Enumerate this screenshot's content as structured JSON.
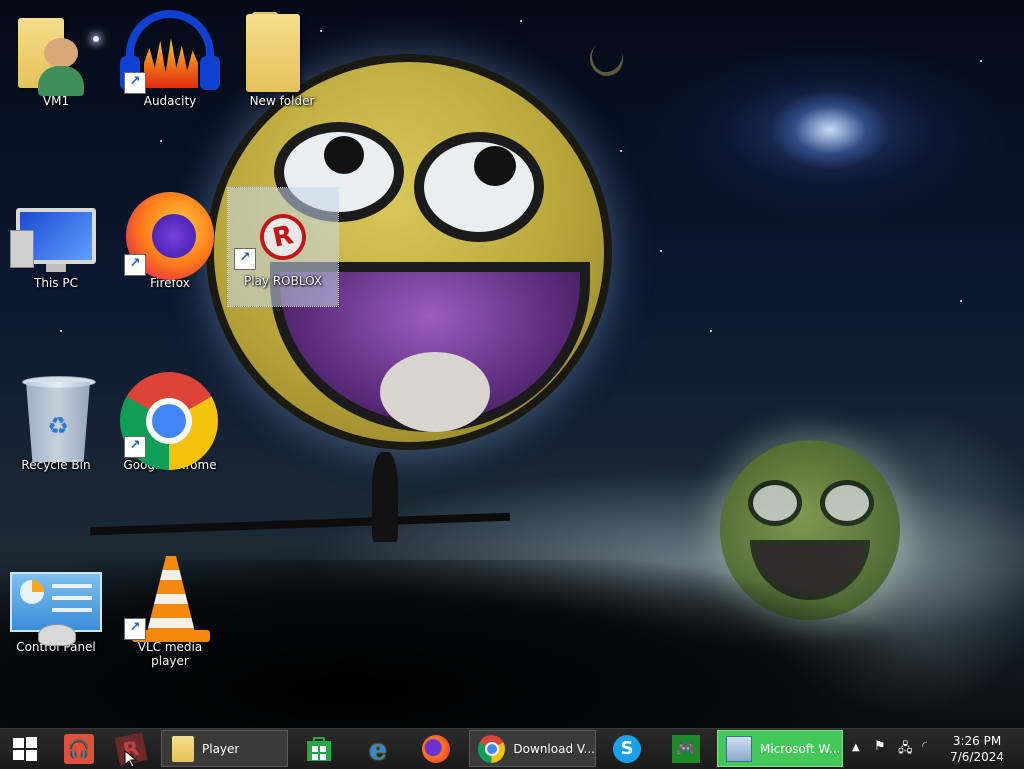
{
  "desktop": {
    "icons": [
      {
        "label": "VM1",
        "icon": "user-folder-icon",
        "shortcut": false
      },
      {
        "label": "Audacity",
        "icon": "audacity-icon",
        "shortcut": true
      },
      {
        "label": "New folder",
        "icon": "folder-icon",
        "shortcut": false
      },
      {
        "label": "This PC",
        "icon": "computer-icon",
        "shortcut": false
      },
      {
        "label": "Firefox",
        "icon": "firefox-icon",
        "shortcut": true
      },
      {
        "label": "Play ROBLOX",
        "icon": "roblox-icon",
        "shortcut": true,
        "selected": true
      },
      {
        "label": "Recycle Bin",
        "icon": "recycle-bin-icon",
        "shortcut": false
      },
      {
        "label": "Google Chrome",
        "icon": "chrome-icon",
        "shortcut": true
      },
      {
        "label": "Control Panel",
        "icon": "control-panel-icon",
        "shortcut": false
      },
      {
        "label": "VLC media player",
        "icon": "vlc-icon",
        "shortcut": true
      }
    ]
  },
  "taskbar": {
    "start_icon": "windows-start-icon",
    "pinned": [
      {
        "icon": "headphones-app-icon"
      },
      {
        "icon": "roblox-taskbar-icon"
      },
      {
        "icon": "store-icon"
      },
      {
        "icon": "internet-explorer-icon"
      },
      {
        "icon": "firefox-taskbar-icon"
      },
      {
        "icon": "skype-icon"
      },
      {
        "icon": "xbox-icon"
      }
    ],
    "windows": [
      {
        "label": "Player",
        "icon": "folder-icon"
      },
      {
        "label": "Download V...",
        "icon": "chrome-icon"
      },
      {
        "label": "Microsoft W...",
        "icon": "installer-icon",
        "active": true
      }
    ],
    "tray": {
      "chevron": "▲",
      "icons": [
        "flag-icon",
        "network-icon",
        "busy-icon"
      ]
    },
    "clock": {
      "time": "3:26 PM",
      "date": "7/6/2024"
    }
  },
  "colors": {
    "taskbar_bg": "#1f1f1f",
    "active_window": "#45c85a",
    "selection": "#c8d7eb"
  }
}
